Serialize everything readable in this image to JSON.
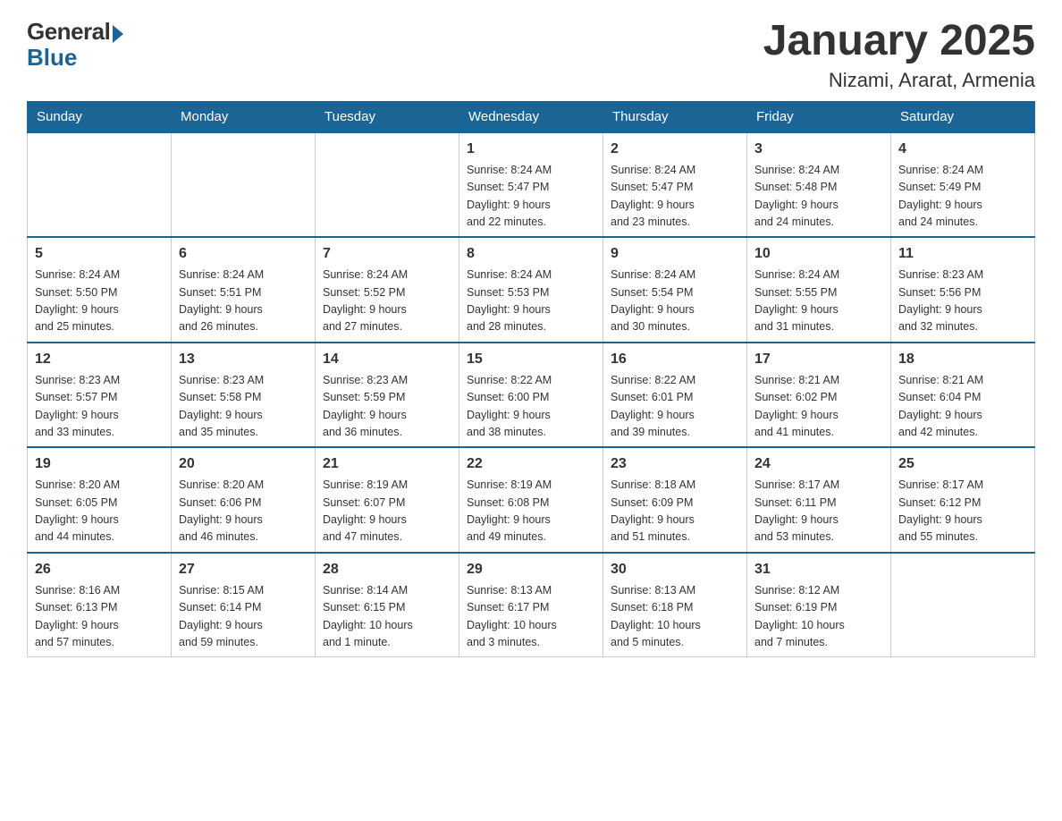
{
  "logo": {
    "general": "General",
    "blue": "Blue"
  },
  "title": "January 2025",
  "location": "Nizami, Ararat, Armenia",
  "weekdays": [
    "Sunday",
    "Monday",
    "Tuesday",
    "Wednesday",
    "Thursday",
    "Friday",
    "Saturday"
  ],
  "weeks": [
    [
      {
        "day": "",
        "info": ""
      },
      {
        "day": "",
        "info": ""
      },
      {
        "day": "",
        "info": ""
      },
      {
        "day": "1",
        "info": "Sunrise: 8:24 AM\nSunset: 5:47 PM\nDaylight: 9 hours\nand 22 minutes."
      },
      {
        "day": "2",
        "info": "Sunrise: 8:24 AM\nSunset: 5:47 PM\nDaylight: 9 hours\nand 23 minutes."
      },
      {
        "day": "3",
        "info": "Sunrise: 8:24 AM\nSunset: 5:48 PM\nDaylight: 9 hours\nand 24 minutes."
      },
      {
        "day": "4",
        "info": "Sunrise: 8:24 AM\nSunset: 5:49 PM\nDaylight: 9 hours\nand 24 minutes."
      }
    ],
    [
      {
        "day": "5",
        "info": "Sunrise: 8:24 AM\nSunset: 5:50 PM\nDaylight: 9 hours\nand 25 minutes."
      },
      {
        "day": "6",
        "info": "Sunrise: 8:24 AM\nSunset: 5:51 PM\nDaylight: 9 hours\nand 26 minutes."
      },
      {
        "day": "7",
        "info": "Sunrise: 8:24 AM\nSunset: 5:52 PM\nDaylight: 9 hours\nand 27 minutes."
      },
      {
        "day": "8",
        "info": "Sunrise: 8:24 AM\nSunset: 5:53 PM\nDaylight: 9 hours\nand 28 minutes."
      },
      {
        "day": "9",
        "info": "Sunrise: 8:24 AM\nSunset: 5:54 PM\nDaylight: 9 hours\nand 30 minutes."
      },
      {
        "day": "10",
        "info": "Sunrise: 8:24 AM\nSunset: 5:55 PM\nDaylight: 9 hours\nand 31 minutes."
      },
      {
        "day": "11",
        "info": "Sunrise: 8:23 AM\nSunset: 5:56 PM\nDaylight: 9 hours\nand 32 minutes."
      }
    ],
    [
      {
        "day": "12",
        "info": "Sunrise: 8:23 AM\nSunset: 5:57 PM\nDaylight: 9 hours\nand 33 minutes."
      },
      {
        "day": "13",
        "info": "Sunrise: 8:23 AM\nSunset: 5:58 PM\nDaylight: 9 hours\nand 35 minutes."
      },
      {
        "day": "14",
        "info": "Sunrise: 8:23 AM\nSunset: 5:59 PM\nDaylight: 9 hours\nand 36 minutes."
      },
      {
        "day": "15",
        "info": "Sunrise: 8:22 AM\nSunset: 6:00 PM\nDaylight: 9 hours\nand 38 minutes."
      },
      {
        "day": "16",
        "info": "Sunrise: 8:22 AM\nSunset: 6:01 PM\nDaylight: 9 hours\nand 39 minutes."
      },
      {
        "day": "17",
        "info": "Sunrise: 8:21 AM\nSunset: 6:02 PM\nDaylight: 9 hours\nand 41 minutes."
      },
      {
        "day": "18",
        "info": "Sunrise: 8:21 AM\nSunset: 6:04 PM\nDaylight: 9 hours\nand 42 minutes."
      }
    ],
    [
      {
        "day": "19",
        "info": "Sunrise: 8:20 AM\nSunset: 6:05 PM\nDaylight: 9 hours\nand 44 minutes."
      },
      {
        "day": "20",
        "info": "Sunrise: 8:20 AM\nSunset: 6:06 PM\nDaylight: 9 hours\nand 46 minutes."
      },
      {
        "day": "21",
        "info": "Sunrise: 8:19 AM\nSunset: 6:07 PM\nDaylight: 9 hours\nand 47 minutes."
      },
      {
        "day": "22",
        "info": "Sunrise: 8:19 AM\nSunset: 6:08 PM\nDaylight: 9 hours\nand 49 minutes."
      },
      {
        "day": "23",
        "info": "Sunrise: 8:18 AM\nSunset: 6:09 PM\nDaylight: 9 hours\nand 51 minutes."
      },
      {
        "day": "24",
        "info": "Sunrise: 8:17 AM\nSunset: 6:11 PM\nDaylight: 9 hours\nand 53 minutes."
      },
      {
        "day": "25",
        "info": "Sunrise: 8:17 AM\nSunset: 6:12 PM\nDaylight: 9 hours\nand 55 minutes."
      }
    ],
    [
      {
        "day": "26",
        "info": "Sunrise: 8:16 AM\nSunset: 6:13 PM\nDaylight: 9 hours\nand 57 minutes."
      },
      {
        "day": "27",
        "info": "Sunrise: 8:15 AM\nSunset: 6:14 PM\nDaylight: 9 hours\nand 59 minutes."
      },
      {
        "day": "28",
        "info": "Sunrise: 8:14 AM\nSunset: 6:15 PM\nDaylight: 10 hours\nand 1 minute."
      },
      {
        "day": "29",
        "info": "Sunrise: 8:13 AM\nSunset: 6:17 PM\nDaylight: 10 hours\nand 3 minutes."
      },
      {
        "day": "30",
        "info": "Sunrise: 8:13 AM\nSunset: 6:18 PM\nDaylight: 10 hours\nand 5 minutes."
      },
      {
        "day": "31",
        "info": "Sunrise: 8:12 AM\nSunset: 6:19 PM\nDaylight: 10 hours\nand 7 minutes."
      },
      {
        "day": "",
        "info": ""
      }
    ]
  ]
}
